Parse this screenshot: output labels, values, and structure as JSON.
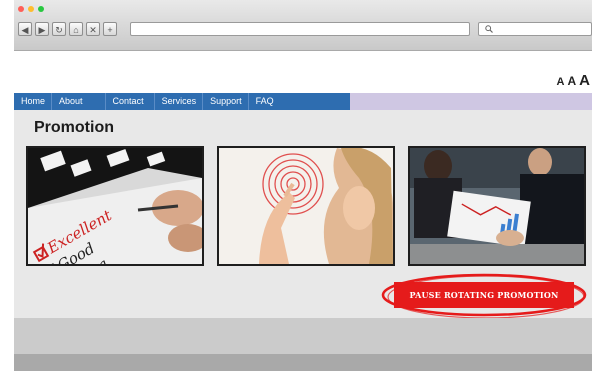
{
  "browser": {
    "buttons": [
      {
        "name": "back-button",
        "glyph": "◀"
      },
      {
        "name": "forward-button",
        "glyph": "▶"
      },
      {
        "name": "reload-button",
        "glyph": "↻"
      },
      {
        "name": "home-button",
        "glyph": "⌂"
      },
      {
        "name": "stop-button",
        "glyph": "✕"
      },
      {
        "name": "new-tab-button",
        "glyph": "+"
      }
    ],
    "window_dot_colors": [
      "#ff5f57",
      "#ffbd2e",
      "#28c840"
    ]
  },
  "text_size": {
    "small": "A",
    "medium": "A",
    "large": "A"
  },
  "nav": {
    "items": [
      "Home",
      "About",
      "Contact",
      "Services",
      "Support",
      "FAQ"
    ]
  },
  "page": {
    "title": "Promotion",
    "pause_button": "PAUSE ROTATING PROMOTION"
  },
  "colors": {
    "nav_blue": "#2e6db0",
    "nav_strip": "#cfc7e3",
    "pause_red": "#e51b1b"
  }
}
